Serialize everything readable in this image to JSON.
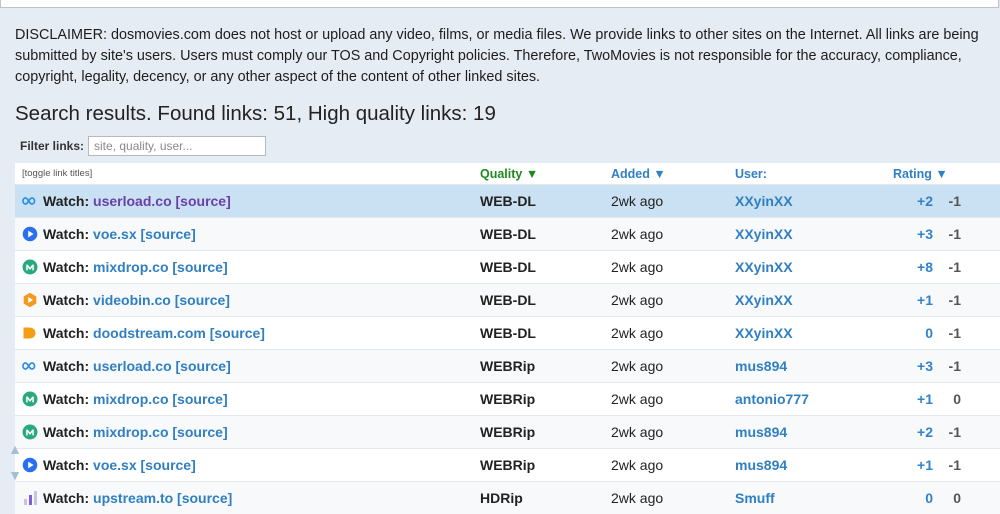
{
  "disclaimer": "DISCLAIMER: dosmovies.com does not host or upload any video, films, or media files. We provide links to other sites on the Internet. All links are being submitted by site's users. Users must comply our TOS and Copyright policies. Therefore, TwoMovies is not responsible for the accuracy, compliance, copyright, legality, decency, or any other aspect of the content of other linked sites.",
  "heading": "Search results. Found links: 51, High quality links: 19",
  "filter": {
    "label": "Filter links:",
    "placeholder": "site, quality, user..."
  },
  "table": {
    "headers": {
      "title": "[toggle link titles]",
      "quality": "Quality ▼",
      "added": "Added ▼",
      "user": "User:",
      "rating": "Rating ▼"
    },
    "rows": [
      {
        "icon": "infinity-icon",
        "color": "#2f8fe6",
        "watch": "Watch:",
        "host": "userload.co [source]",
        "quality": "WEB-DL",
        "added": "2wk ago",
        "user": "XXyinXX",
        "up": "+2",
        "down": "-1"
      },
      {
        "icon": "play-circle-icon",
        "color": "#2a6ff0",
        "watch": "Watch:",
        "host": "voe.sx [source]",
        "quality": "WEB-DL",
        "added": "2wk ago",
        "user": "XXyinXX",
        "up": "+3",
        "down": "-1"
      },
      {
        "icon": "mixdrop-m-icon",
        "color": "#2aa87f",
        "watch": "Watch:",
        "host": "mixdrop.co [source]",
        "quality": "WEB-DL",
        "added": "2wk ago",
        "user": "XXyinXX",
        "up": "+8",
        "down": "-1"
      },
      {
        "icon": "videobin-play-icon",
        "color": "#f39a1e",
        "watch": "Watch:",
        "host": "videobin.co [source]",
        "quality": "WEB-DL",
        "added": "2wk ago",
        "user": "XXyinXX",
        "up": "+1",
        "down": "-1"
      },
      {
        "icon": "doodstream-d-icon",
        "color": "#f59d14",
        "watch": "Watch:",
        "host": "doodstream.com [source]",
        "quality": "WEB-DL",
        "added": "2wk ago",
        "user": "XXyinXX",
        "up": "0",
        "down": "-1"
      },
      {
        "icon": "infinity-icon",
        "color": "#2f8fe6",
        "watch": "Watch:",
        "host": "userload.co [source]",
        "quality": "WEBRip",
        "added": "2wk ago",
        "user": "mus894",
        "up": "+3",
        "down": "-1"
      },
      {
        "icon": "mixdrop-m-icon",
        "color": "#2aa87f",
        "watch": "Watch:",
        "host": "mixdrop.co [source]",
        "quality": "WEBRip",
        "added": "2wk ago",
        "user": "antonio777",
        "up": "+1",
        "down": "0"
      },
      {
        "icon": "mixdrop-m-icon",
        "color": "#2aa87f",
        "watch": "Watch:",
        "host": "mixdrop.co [source]",
        "quality": "WEBRip",
        "added": "2wk ago",
        "user": "mus894",
        "up": "+2",
        "down": "-1"
      },
      {
        "icon": "play-circle-icon",
        "color": "#2a6ff0",
        "watch": "Watch:",
        "host": "voe.sx [source]",
        "quality": "WEBRip",
        "added": "2wk ago",
        "user": "mus894",
        "up": "+1",
        "down": "-1"
      },
      {
        "icon": "upstream-bars-icon",
        "color": "#7d5fd8",
        "watch": "Watch:",
        "host": "upstream.to [source]",
        "quality": "HDRip",
        "added": "2wk ago",
        "user": "Smuff",
        "up": "0",
        "down": "0"
      }
    ]
  },
  "scroll": {
    "up_icon": "arrow-up-icon",
    "down_icon": "arrow-down-icon"
  }
}
